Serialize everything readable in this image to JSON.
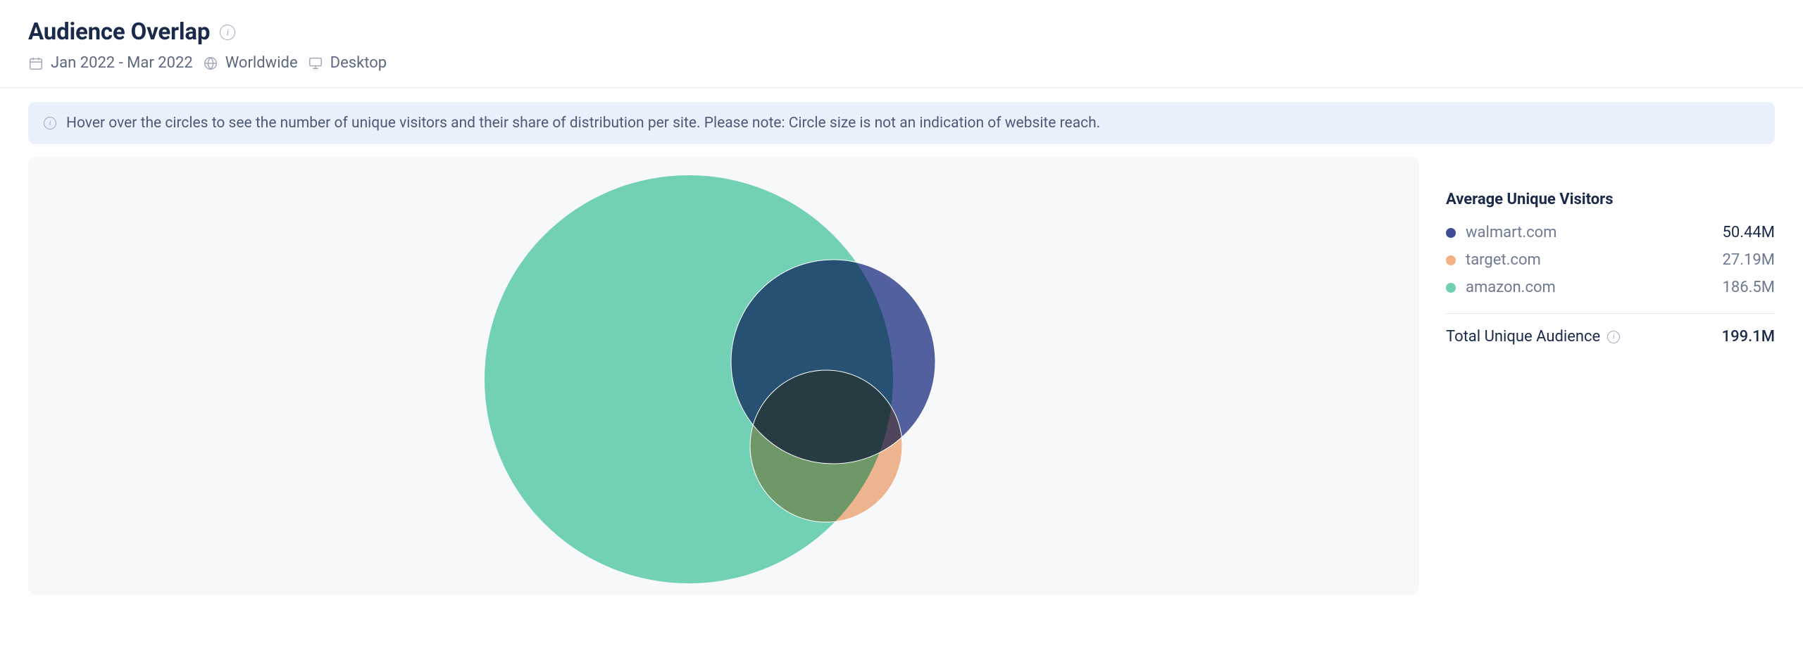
{
  "header": {
    "title": "Audience Overlap",
    "date_range": "Jan 2022 - Mar 2022",
    "region": "Worldwide",
    "device": "Desktop"
  },
  "notice": "Hover over the circles to see the number of unique visitors and their share of distribution per site. Please note: Circle size is not an indication of website reach.",
  "sidebar": {
    "title": "Average Unique Visitors",
    "total_label": "Total Unique Audience",
    "total_value": "199.1M"
  },
  "legend": [
    {
      "name": "walmart.com",
      "value": "50.44M",
      "color": "#3f4d95"
    },
    {
      "name": "target.com",
      "value": "27.19M",
      "color": "#f4b183"
    },
    {
      "name": "amazon.com",
      "value": "186.5M",
      "color": "#72d0b4"
    }
  ],
  "chart_data": {
    "type": "venn",
    "title": "Audience Overlap",
    "sets": [
      {
        "name": "amazon.com",
        "value": 186.5,
        "color": "#72d0b4"
      },
      {
        "name": "walmart.com",
        "value": 50.44,
        "color": "#3f4d95"
      },
      {
        "name": "target.com",
        "value": 27.19,
        "color": "#f4b183"
      }
    ],
    "total_unique": 199.1,
    "units": "millions of unique visitors",
    "note": "Circle size is not an indication of website reach; heavy overlap among all three, walmart and target almost fully inside amazon."
  }
}
